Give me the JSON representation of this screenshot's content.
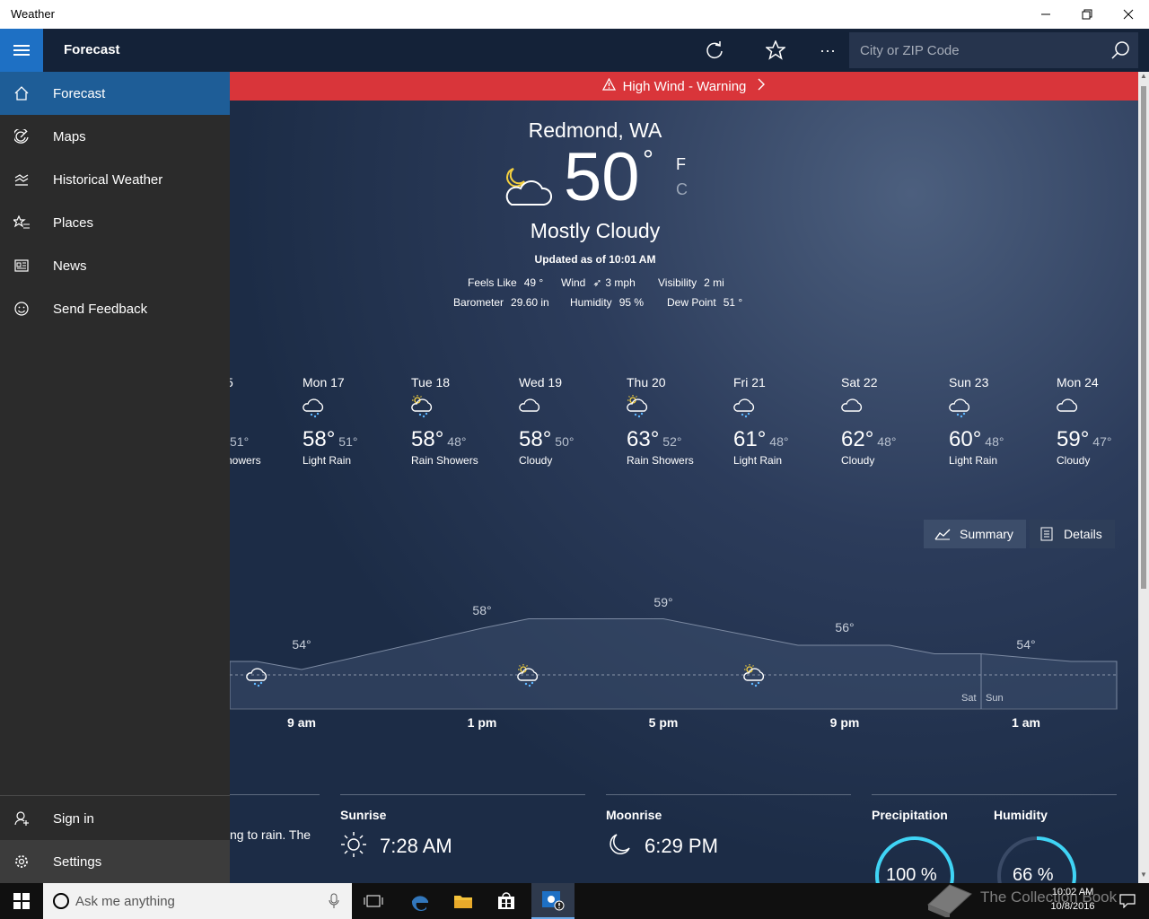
{
  "window": {
    "title": "Weather"
  },
  "appbar": {
    "title": "Forecast",
    "search_placeholder": "City or ZIP Code",
    "more": "···"
  },
  "alert": {
    "text": "High Wind - Warning"
  },
  "current": {
    "location": "Redmond, WA",
    "temp": "50",
    "deg": "°",
    "unit_f": "F",
    "unit_c": "C",
    "condition": "Mostly Cloudy",
    "updated": "Updated as of 10:01 AM",
    "stats": [
      {
        "label": "Feels Like",
        "value": "49 °"
      },
      {
        "label": "Wind",
        "value": "3 mph"
      },
      {
        "label": "Visibility",
        "value": "2 mi"
      },
      {
        "label": "Barometer",
        "value": "29.60 in"
      },
      {
        "label": "Humidity",
        "value": "95 %"
      },
      {
        "label": "Dew Point",
        "value": "51 °"
      }
    ]
  },
  "daily": [
    {
      "day": "5",
      "hi": "",
      "lo": "51°",
      "cond": "howers",
      "icon": "rain-showers"
    },
    {
      "day": "Mon 17",
      "hi": "58°",
      "lo": "51°",
      "cond": "Light Rain",
      "icon": "light-rain"
    },
    {
      "day": "Tue 18",
      "hi": "58°",
      "lo": "48°",
      "cond": "Rain Showers",
      "icon": "rain-showers"
    },
    {
      "day": "Wed 19",
      "hi": "58°",
      "lo": "50°",
      "cond": "Cloudy",
      "icon": "cloudy"
    },
    {
      "day": "Thu 20",
      "hi": "63°",
      "lo": "52°",
      "cond": "Rain Showers",
      "icon": "rain-showers"
    },
    {
      "day": "Fri 21",
      "hi": "61°",
      "lo": "48°",
      "cond": "Light Rain",
      "icon": "light-rain"
    },
    {
      "day": "Sat 22",
      "hi": "62°",
      "lo": "48°",
      "cond": "Cloudy",
      "icon": "cloudy"
    },
    {
      "day": "Sun 23",
      "hi": "60°",
      "lo": "48°",
      "cond": "Light Rain",
      "icon": "light-rain"
    },
    {
      "day": "Mon 24",
      "hi": "59°",
      "lo": "47°",
      "cond": "Cloudy",
      "icon": "cloudy"
    }
  ],
  "view_toggle": {
    "summary": "Summary",
    "details": "Details"
  },
  "hourly": {
    "times": [
      "9 am",
      "1 pm",
      "5 pm",
      "9 pm",
      "1 am"
    ],
    "temps": [
      {
        "t": 54,
        "label": "54°"
      },
      {
        "t": 58,
        "label": "58°"
      },
      {
        "t": 59,
        "label": "59°"
      },
      {
        "t": 56,
        "label": "56°"
      },
      {
        "t": 54,
        "label": "54°"
      }
    ],
    "day_labels": [
      "Sat",
      "Sun"
    ]
  },
  "details": {
    "summary_text": "ng to rain. The",
    "sunrise_label": "Sunrise",
    "sunrise": "7:28 AM",
    "moonrise_label": "Moonrise",
    "moonrise": "6:29 PM",
    "precip_label": "Precipitation",
    "precip": "100 %",
    "precip_pct": 100,
    "humidity_label": "Humidity",
    "humidity": "66 %",
    "humidity_pct": 66
  },
  "nav": {
    "items": [
      {
        "label": "Forecast",
        "icon": "home-icon"
      },
      {
        "label": "Maps",
        "icon": "radar-icon"
      },
      {
        "label": "Historical Weather",
        "icon": "chart-icon"
      },
      {
        "label": "Places",
        "icon": "star-list-icon"
      },
      {
        "label": "News",
        "icon": "news-icon"
      },
      {
        "label": "Send Feedback",
        "icon": "smiley-icon"
      }
    ],
    "sign_in": "Sign in",
    "settings": "Settings"
  },
  "taskbar": {
    "search_placeholder": "Ask me anything",
    "time": "10:02 AM",
    "date": "10/8/2016"
  },
  "watermark": {
    "text": "The Collection Book"
  },
  "colors": {
    "accent": "#1e70c4",
    "alert": "#d9353a",
    "sidebar": "#2b2b2b",
    "appbar": "#142238"
  }
}
